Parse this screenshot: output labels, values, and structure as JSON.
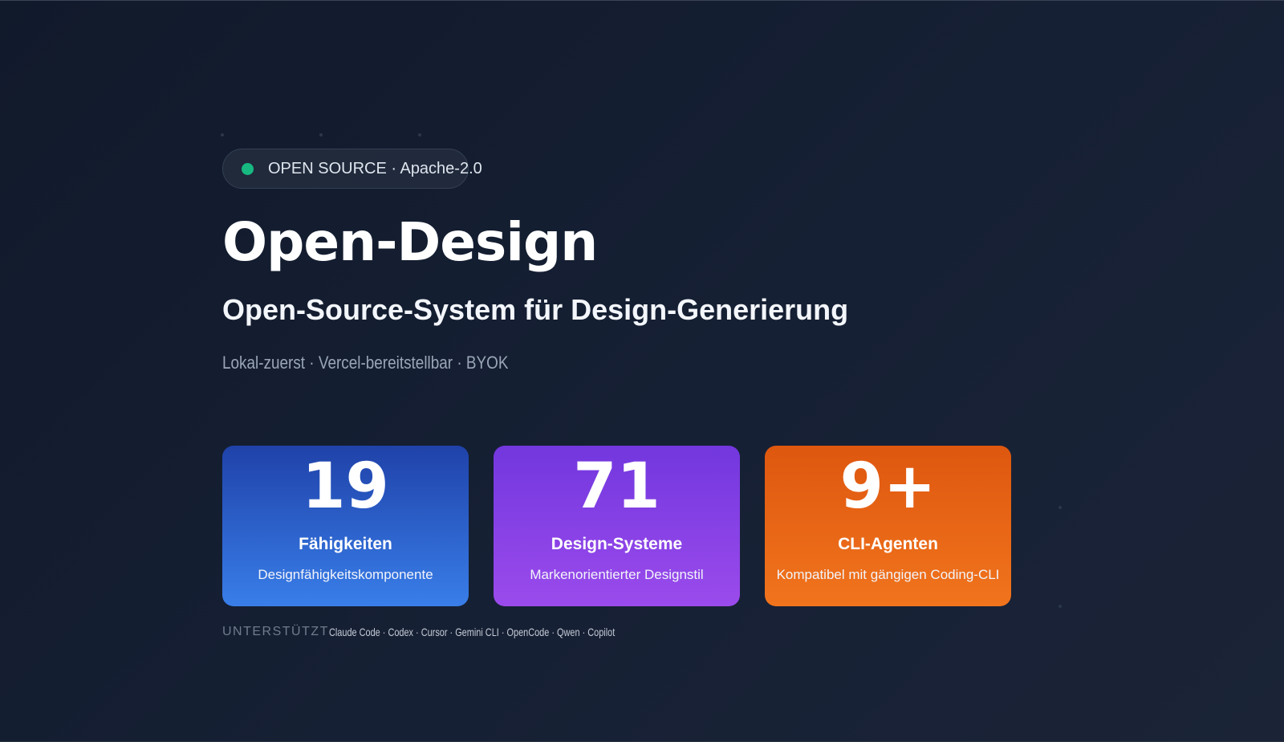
{
  "badge": {
    "status_color": "#17b981",
    "text": "OPEN SOURCE · Apache-2.0"
  },
  "hero": {
    "title": "Open-Design",
    "subtitle": "Open-Source-System für Design-Generierung",
    "tags": "Lokal-zuerst · Vercel-bereitstellbar · BYOK"
  },
  "stats": [
    {
      "number": "19",
      "label": "Fähigkeiten",
      "description": "Designfähigkeitskomponente",
      "color": "#2f65d6"
    },
    {
      "number": "71",
      "label": "Design-Systeme",
      "description": "Markenorientierter Designstil",
      "color": "#8a42e6"
    },
    {
      "number": "9+",
      "label": "CLI-Agenten",
      "description": "Kompatibel mit gängigen Coding-CLI",
      "color": "#ea6517"
    }
  ],
  "support": {
    "label": "UNTERSTÜTZT",
    "agents": "Claude Code · Codex · Cursor · Gemini CLI · OpenCode · Qwen · Copilot"
  }
}
